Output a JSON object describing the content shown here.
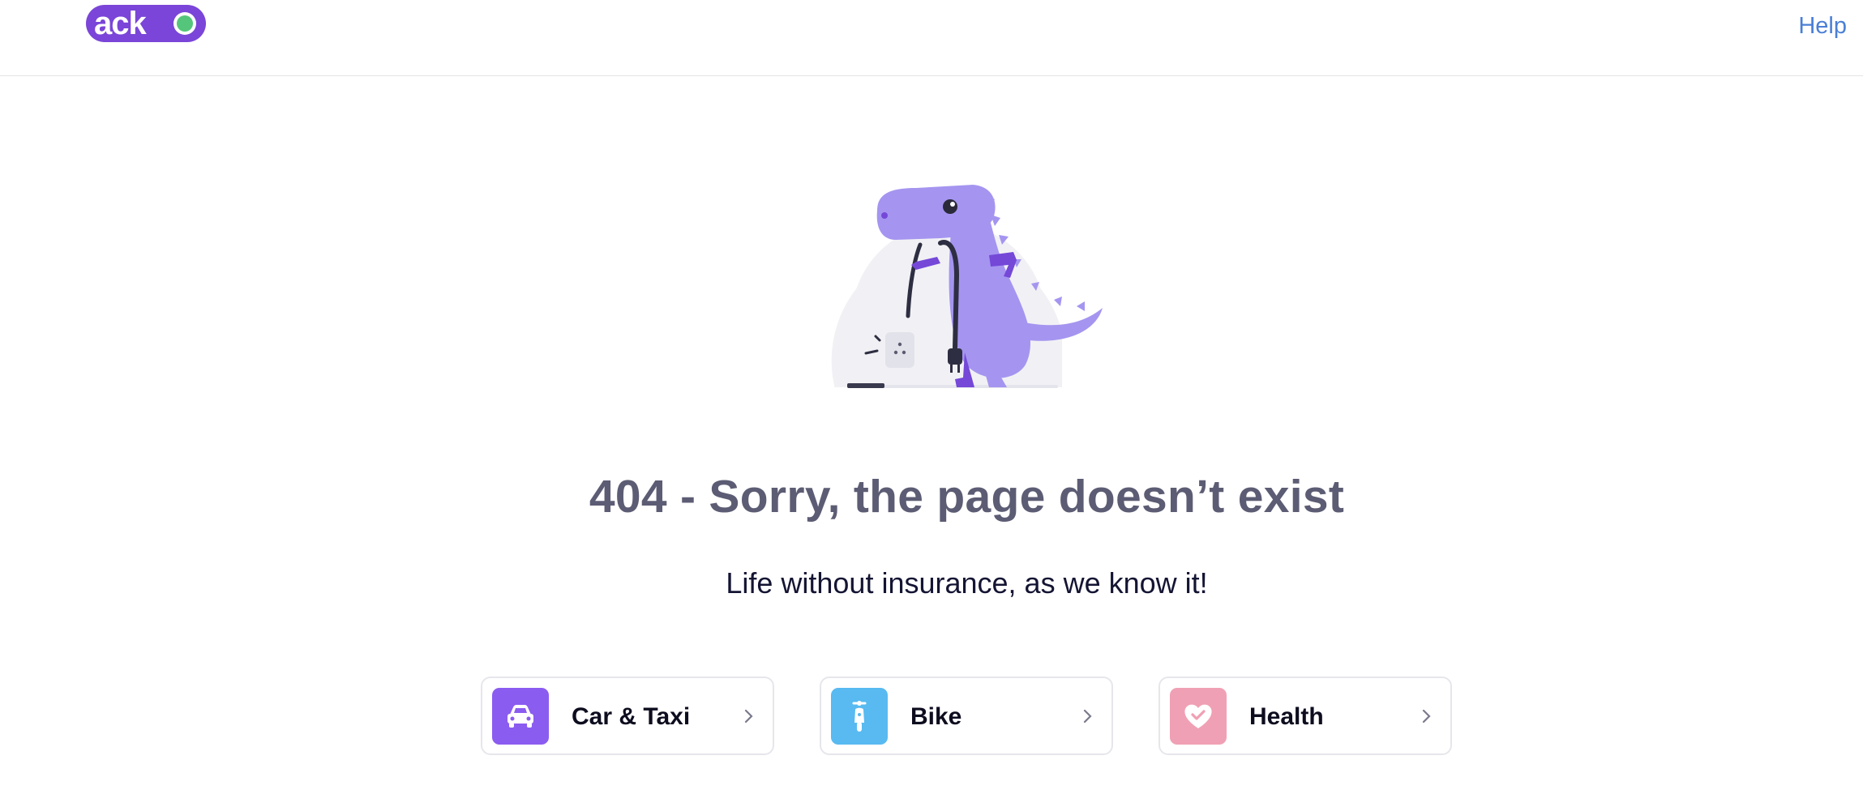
{
  "header": {
    "logo_text": "acko",
    "help_label": "Help"
  },
  "error": {
    "title": "404 - Sorry, the page doesn’t exist",
    "subtitle": "Life without insurance, as we know it!"
  },
  "products": [
    {
      "label": "Car & Taxi",
      "icon": "car-icon",
      "color": "#8b5cf0"
    },
    {
      "label": "Bike",
      "icon": "scooter-icon",
      "color": "#58baf0"
    },
    {
      "label": "Health",
      "icon": "heart-check-icon",
      "color": "#f0a0b4"
    }
  ],
  "colors": {
    "brand_purple": "#7a45d8",
    "brand_green": "#54c57a",
    "link_blue": "#4a7fd6"
  }
}
